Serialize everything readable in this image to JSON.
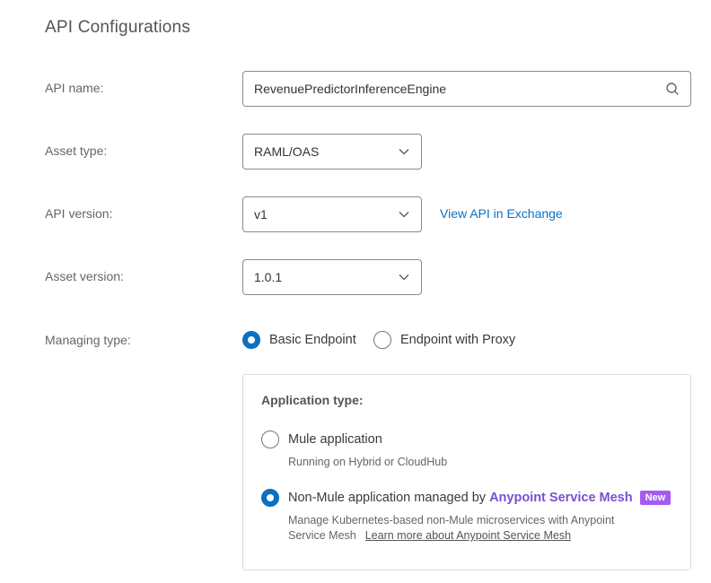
{
  "page": {
    "title": "API Configurations"
  },
  "api_name": {
    "label": "API name:",
    "value": "RevenuePredictorInferenceEngine"
  },
  "asset_type": {
    "label": "Asset type:",
    "value": "RAML/OAS"
  },
  "api_version": {
    "label": "API version:",
    "value": "v1",
    "link": "View API in Exchange"
  },
  "asset_version": {
    "label": "Asset version:",
    "value": "1.0.1"
  },
  "managing_type": {
    "label": "Managing type:",
    "options": [
      {
        "label": "Basic Endpoint",
        "checked": true
      },
      {
        "label": "Endpoint with Proxy",
        "checked": false
      }
    ]
  },
  "application_type": {
    "title": "Application type:",
    "mule": {
      "label": "Mule application",
      "description": "Running on Hybrid or CloudHub",
      "checked": false
    },
    "non_mule": {
      "label": "Non-Mule application managed by",
      "brand": "Anypoint Service Mesh",
      "badge": "New",
      "description_line1": "Manage Kubernetes-based non-Mule microservices with Anypoint",
      "description_line2": "Service Mesh",
      "learn_more": "Learn more about Anypoint Service Mesh",
      "checked": true
    }
  },
  "colors": {
    "accent": "#0b70c2",
    "brand_purple": "#7b4fd0",
    "badge_bg": "#a55bf0"
  },
  "icons": {
    "search": "search-icon",
    "dropdown": "chevron-down-icon"
  }
}
